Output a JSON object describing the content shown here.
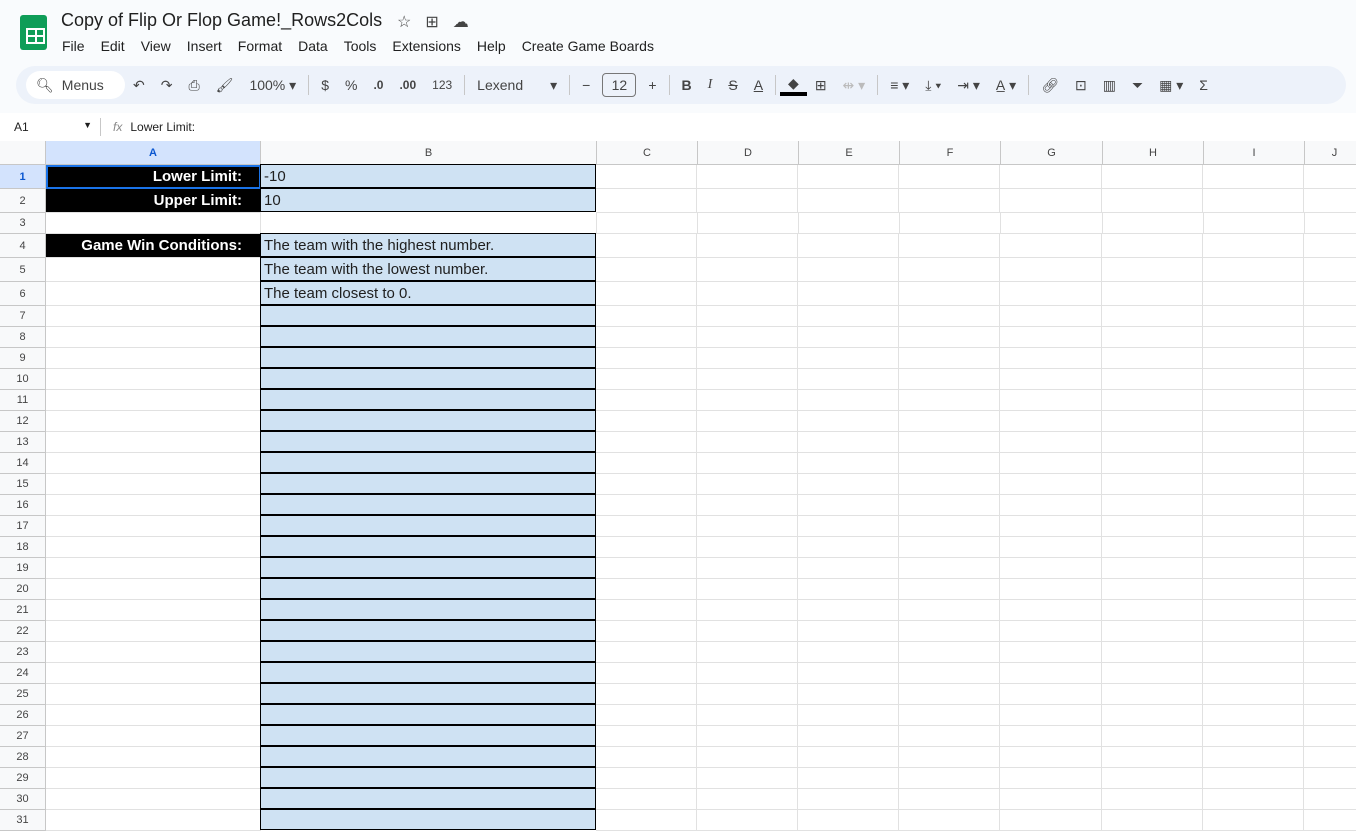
{
  "title": "Copy of Flip Or Flop Game!_Rows2Cols",
  "title_icons": [
    "star-icon",
    "move-to-folder-icon",
    "cloud-saved-icon"
  ],
  "menu": [
    "File",
    "Edit",
    "View",
    "Insert",
    "Format",
    "Data",
    "Tools",
    "Extensions",
    "Help",
    "Create Game Boards"
  ],
  "toolbar": {
    "search": "Menus",
    "zoom": "100%",
    "currency": "$",
    "percent": "%",
    "dec_decrease": ".0",
    "dec_increase": ".00",
    "format_num": "123",
    "font": "Lexend",
    "font_size": "12"
  },
  "formula_bar": {
    "cell_ref": "A1",
    "content": "Lower Limit:"
  },
  "columns": [
    "A",
    "B",
    "C",
    "D",
    "E",
    "F",
    "G",
    "H",
    "I",
    "J"
  ],
  "cells": {
    "A1": "Lower Limit:",
    "B1": "-10",
    "A2": "Upper Limit:",
    "B2": "10",
    "A4": "Game Win Conditions:",
    "B4": "The team with the highest number.",
    "B5": "The team with the lowest number.",
    "B6": "The team closest to 0."
  },
  "row_count": 31
}
